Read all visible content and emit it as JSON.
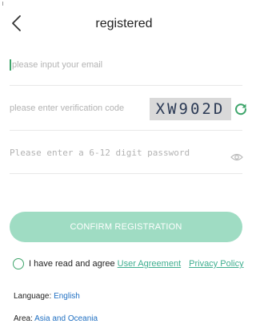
{
  "header": {
    "title": "registered"
  },
  "form": {
    "email_placeholder": "please input your email",
    "code_placeholder": "please enter verification code",
    "captcha_text": "XW902D",
    "password_placeholder": "Please enter a 6-12 digit password"
  },
  "confirm_label": "CONFIRM REGISTRATION",
  "agreement": {
    "text": "I have read and agree",
    "user_agreement": "User Agreement",
    "privacy_policy": "Privacy Policy"
  },
  "language": {
    "label": "Language:",
    "value": "English"
  },
  "area": {
    "label": "Area:",
    "value": "Asia and Oceania"
  },
  "colors": {
    "accent": "#3ea56b",
    "button": "#9fdcc3",
    "link": "#1f6fc2",
    "agreement_link": "#3fae8f"
  },
  "icons": [
    "back-arrow-icon",
    "refresh-icon",
    "eye-icon",
    "radio-icon"
  ]
}
